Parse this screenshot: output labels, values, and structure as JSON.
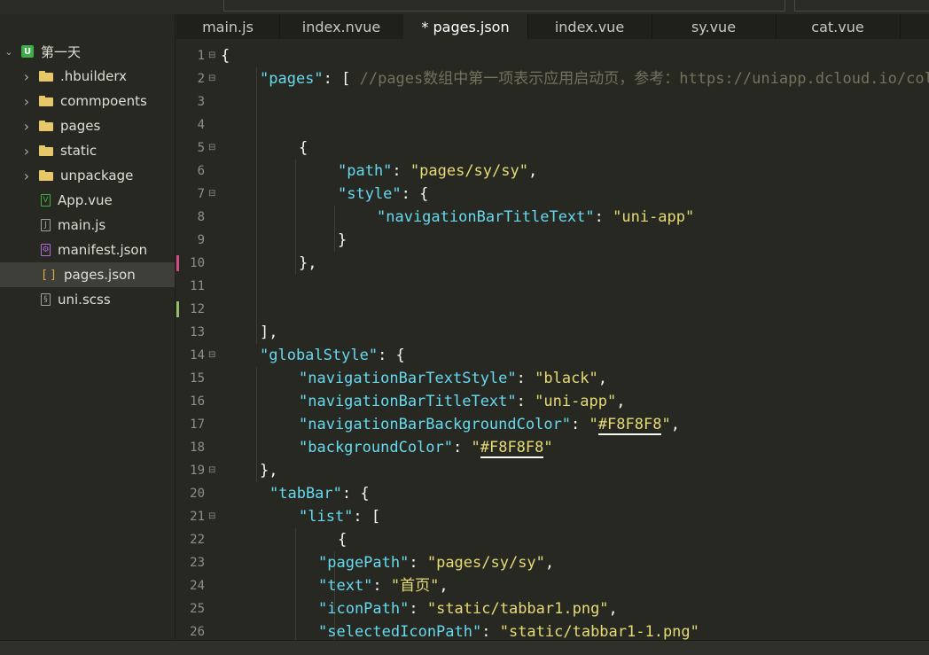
{
  "project": {
    "name": "第一天"
  },
  "sidebar": {
    "items": [
      {
        "label": ".hbuilderx",
        "type": "folder",
        "icon": "folder-icon"
      },
      {
        "label": "commpoents",
        "type": "folder",
        "icon": "folder-icon"
      },
      {
        "label": "pages",
        "type": "folder",
        "icon": "folder-icon"
      },
      {
        "label": "static",
        "type": "folder",
        "icon": "folder-icon"
      },
      {
        "label": "unpackage",
        "type": "folder",
        "icon": "folder-icon"
      },
      {
        "label": "App.vue",
        "type": "file",
        "icon": "vue-file-icon",
        "glyph": "V",
        "color": "#3fae4a"
      },
      {
        "label": "main.js",
        "type": "file",
        "icon": "js-file-icon",
        "glyph": "J",
        "color": "#9aa0a6"
      },
      {
        "label": "manifest.json",
        "type": "file",
        "icon": "manifest-file-icon",
        "glyph": "⚙",
        "color": "#b86adf"
      },
      {
        "label": "pages.json",
        "type": "file",
        "icon": "json-file-icon",
        "glyph": "[ ]",
        "color": "#e0a848",
        "selected": true
      },
      {
        "label": "uni.scss",
        "type": "file",
        "icon": "scss-file-icon",
        "glyph": "§",
        "color": "#9aa0a6"
      }
    ]
  },
  "tabs": [
    {
      "label": "main.js"
    },
    {
      "label": "index.nvue"
    },
    {
      "label": "* pages.json",
      "active": true
    },
    {
      "label": "index.vue"
    },
    {
      "label": "sy.vue"
    },
    {
      "label": "cat.vue"
    }
  ],
  "colors": {
    "key": "#66d9ef",
    "string": "#e6db74",
    "punct": "#f8f8f2",
    "comment": "#75715e",
    "background": "#272822"
  },
  "editor": {
    "lines": [
      {
        "n": "1",
        "fold": true,
        "ind": 0,
        "tokens": [
          [
            "p",
            "{"
          ]
        ]
      },
      {
        "n": "2",
        "fold": true,
        "ind": 1,
        "tokens": [
          [
            "k",
            "\"pages\""
          ],
          [
            "p",
            ": [ "
          ],
          [
            "c",
            "//pages数组中第一项表示应用启动页，参考：https://uniapp.dcloud.io/collocation/pages"
          ]
        ]
      },
      {
        "n": "3",
        "ind": 0,
        "tokens": []
      },
      {
        "n": "4",
        "ind": 0,
        "tokens": []
      },
      {
        "n": "5",
        "fold": true,
        "ind": 2,
        "tokens": [
          [
            "p",
            "{"
          ]
        ]
      },
      {
        "n": "6",
        "ind": 3,
        "tokens": [
          [
            "k",
            "\"path\""
          ],
          [
            "p",
            ": "
          ],
          [
            "s",
            "\"pages/sy/sy\""
          ],
          [
            "p",
            ","
          ]
        ]
      },
      {
        "n": "7",
        "fold": true,
        "ind": 3,
        "tokens": [
          [
            "k",
            "\"style\""
          ],
          [
            "p",
            ": {"
          ]
        ]
      },
      {
        "n": "8",
        "ind": 4,
        "tokens": [
          [
            "k",
            "\"navigationBarTitleText\""
          ],
          [
            "p",
            ": "
          ],
          [
            "s",
            "\"uni-app\""
          ]
        ]
      },
      {
        "n": "9",
        "ind": 3,
        "tokens": [
          [
            "p",
            "}"
          ]
        ]
      },
      {
        "n": "10",
        "ind": 2,
        "tokens": [
          [
            "p",
            "},"
          ]
        ],
        "mark": "#d14a8a"
      },
      {
        "n": "11",
        "ind": 0,
        "tokens": []
      },
      {
        "n": "12",
        "ind": 0,
        "tokens": [],
        "mark": "#8fbf6a"
      },
      {
        "n": "13",
        "ind": 1,
        "tokens": [
          [
            "p",
            "],"
          ]
        ]
      },
      {
        "n": "14",
        "fold": true,
        "ind": 1,
        "tokens": [
          [
            "k",
            "\"globalStyle\""
          ],
          [
            "p",
            ": {"
          ]
        ]
      },
      {
        "n": "15",
        "ind": 2,
        "tokens": [
          [
            "k",
            "\"navigationBarTextStyle\""
          ],
          [
            "p",
            ": "
          ],
          [
            "s",
            "\"black\""
          ],
          [
            "p",
            ","
          ]
        ]
      },
      {
        "n": "16",
        "ind": 2,
        "tokens": [
          [
            "k",
            "\"navigationBarTitleText\""
          ],
          [
            "p",
            ": "
          ],
          [
            "s",
            "\"uni-app\""
          ],
          [
            "p",
            ","
          ]
        ]
      },
      {
        "n": "17",
        "ind": 2,
        "tokens": [
          [
            "k",
            "\"navigationBarBackgroundColor\""
          ],
          [
            "p",
            ": "
          ],
          [
            "s",
            "\""
          ],
          [
            "su",
            "#F8F8F8"
          ],
          [
            "s",
            "\""
          ],
          [
            "p",
            ","
          ]
        ]
      },
      {
        "n": "18",
        "ind": 2,
        "tokens": [
          [
            "k",
            "\"backgroundColor\""
          ],
          [
            "p",
            ": "
          ],
          [
            "s",
            "\""
          ],
          [
            "su",
            "#F8F8F8"
          ],
          [
            "s",
            "\""
          ]
        ]
      },
      {
        "n": "19",
        "fold": true,
        "ind": 1,
        "tokens": [
          [
            "p",
            "},"
          ]
        ]
      },
      {
        "n": "20",
        "ind": 1.25,
        "tokens": [
          [
            "k",
            "\"tabBar\""
          ],
          [
            "p",
            ": {"
          ]
        ]
      },
      {
        "n": "21",
        "fold": true,
        "ind": 2,
        "tokens": [
          [
            "k",
            "\"list\""
          ],
          [
            "p",
            ": ["
          ]
        ]
      },
      {
        "n": "22",
        "ind": 3,
        "tokens": [
          [
            "p",
            "{"
          ]
        ]
      },
      {
        "n": "23",
        "ind": 2.5,
        "tokens": [
          [
            "k",
            "\"pagePath\""
          ],
          [
            "p",
            ": "
          ],
          [
            "s",
            "\"pages/sy/sy\""
          ],
          [
            "p",
            ","
          ]
        ]
      },
      {
        "n": "24",
        "ind": 2.5,
        "tokens": [
          [
            "k",
            "\"text\""
          ],
          [
            "p",
            ": "
          ],
          [
            "s",
            "\"首页\""
          ],
          [
            "p",
            ","
          ]
        ]
      },
      {
        "n": "25",
        "ind": 2.5,
        "tokens": [
          [
            "k",
            "\"iconPath\""
          ],
          [
            "p",
            ": "
          ],
          [
            "s",
            "\"static/tabbar1.png\""
          ],
          [
            "p",
            ","
          ]
        ]
      },
      {
        "n": "26",
        "ind": 2.5,
        "tokens": [
          [
            "k",
            "\"selectedIconPath\""
          ],
          [
            "p",
            ": "
          ],
          [
            "s",
            "\"static/tabbar1-1.png\""
          ]
        ]
      }
    ]
  }
}
